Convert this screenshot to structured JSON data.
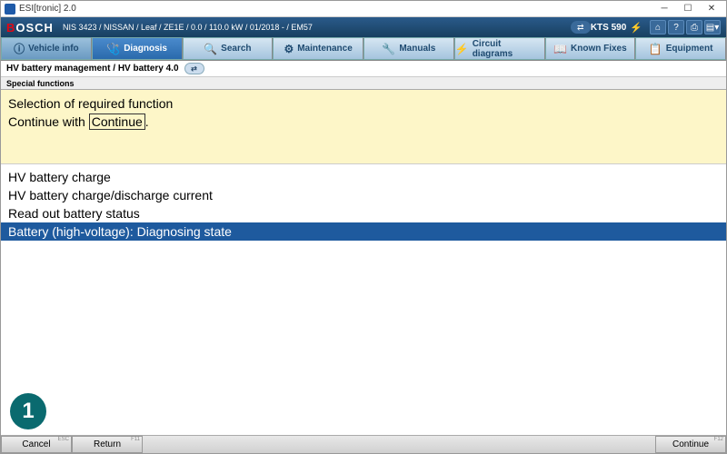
{
  "app": {
    "title": "ESI[tronic] 2.0"
  },
  "header": {
    "logo_prefix": "B",
    "logo_rest": "OSCH",
    "vehicle": "NIS 3423 / NISSAN / Leaf / ZE1E / 0.0 / 110.0 kW / 01/2018 - / EM57",
    "device": "KTS 590"
  },
  "nav": {
    "vehicle_info": "Vehicle info",
    "diagnosis": "Diagnosis",
    "search": "Search",
    "maintenance": "Maintenance",
    "manuals": "Manuals",
    "circuit_diagrams": "Circuit diagrams",
    "known_fixes": "Known Fixes",
    "equipment": "Equipment"
  },
  "breadcrumb": {
    "path": "HV battery management / HV battery 4.0"
  },
  "section": {
    "title": "Special functions"
  },
  "instruction": {
    "line1": "Selection of required function",
    "line2a": "Continue with",
    "line2b": "Continue",
    "line2c": "."
  },
  "functions": {
    "items": [
      {
        "label": "HV battery charge",
        "selected": false
      },
      {
        "label": "HV battery charge/discharge current",
        "selected": false
      },
      {
        "label": "Read out battery status",
        "selected": false
      },
      {
        "label": "Battery (high-voltage): Diagnosing state",
        "selected": true
      }
    ]
  },
  "badge": {
    "number": "1"
  },
  "footer": {
    "cancel": "Cancel",
    "return": "Return",
    "continue": "Continue"
  }
}
